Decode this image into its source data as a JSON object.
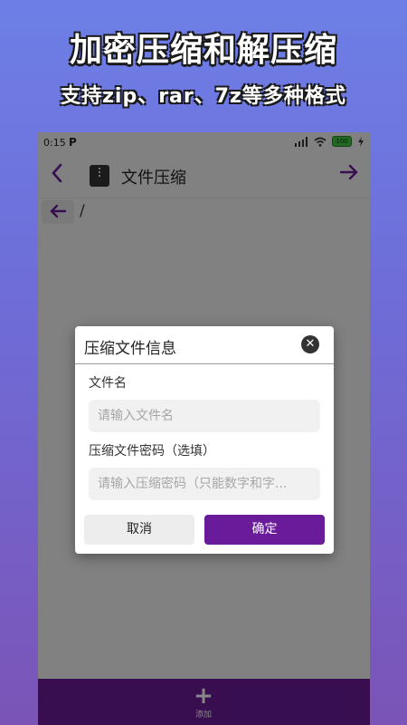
{
  "promo": {
    "title": "加密压缩和解压缩",
    "subtitle": "支持zip、rar、7z等多种格式"
  },
  "status_bar": {
    "time": "0:15",
    "notification_glyph": "P",
    "battery_text": "100",
    "icons": [
      "hd-signal-icon",
      "wifi-icon",
      "battery-icon",
      "charging-icon"
    ]
  },
  "app_bar": {
    "title": "文件压缩",
    "back_icon": "chevron-left-icon",
    "forward_icon": "arrow-right-icon"
  },
  "path_bar": {
    "up_icon": "arrow-left-icon",
    "path": "/"
  },
  "bottom_bar": {
    "add_label": "添加",
    "add_icon": "plus-icon"
  },
  "dialog": {
    "title": "压缩文件信息",
    "close_icon": "close-circle-icon",
    "filename": {
      "label": "文件名",
      "placeholder": "请输入文件名",
      "value": ""
    },
    "password": {
      "label": "压缩文件密码（选填）",
      "placeholder": "请输入压缩密码（只能数字和字...",
      "value": ""
    },
    "cancel_label": "取消",
    "confirm_label": "确定"
  },
  "colors": {
    "accent": "#6a1b9a",
    "promo_gradient_top": "#6d7fe6",
    "promo_gradient_bottom": "#7b54b7",
    "overlay": "#000000"
  }
}
